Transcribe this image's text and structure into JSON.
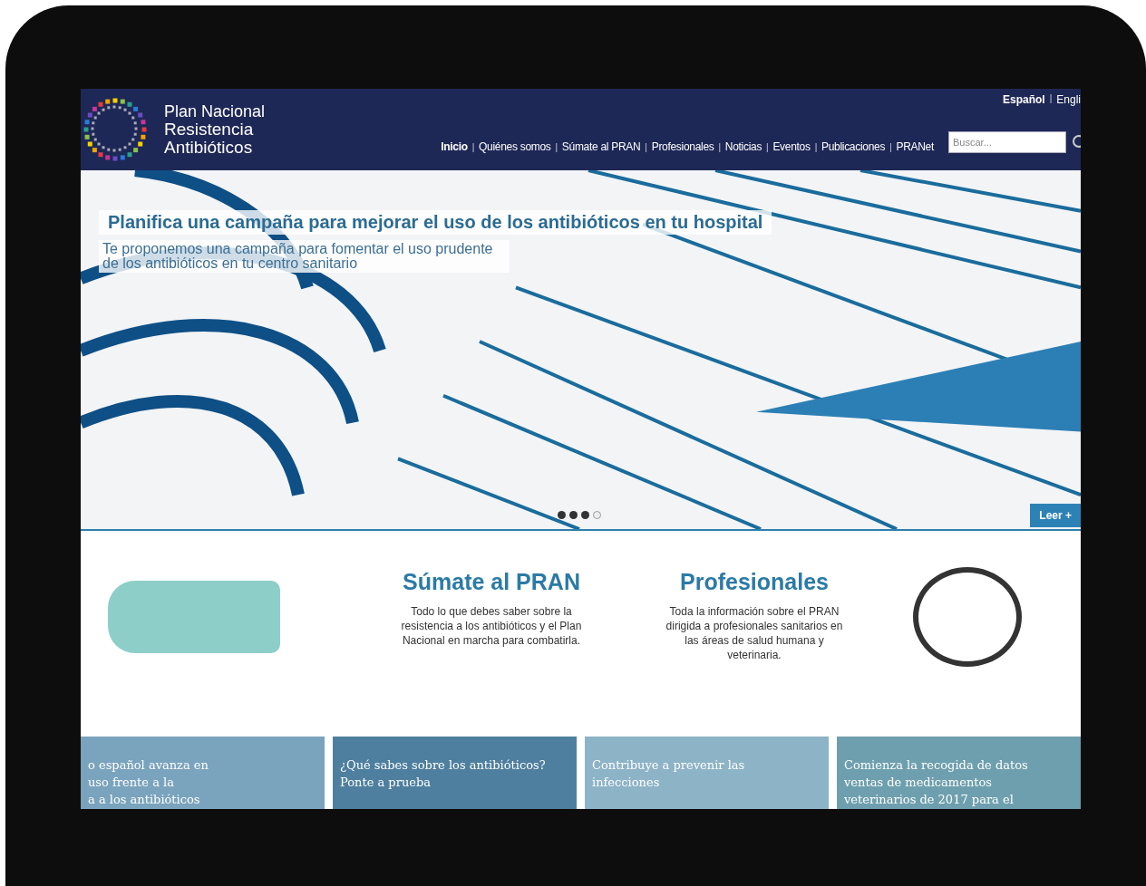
{
  "header": {
    "logo_lines": [
      "Plan Nacional",
      "Resistencia",
      "Antibióticos"
    ],
    "languages": [
      {
        "label": "Español",
        "selected": true
      },
      {
        "label": "Engli",
        "selected": false
      }
    ],
    "separator": "|",
    "nav": [
      {
        "label": "Inicio",
        "selected": true
      },
      {
        "label": "Quiénes somos",
        "selected": false
      },
      {
        "label": "Súmate al PRAN",
        "selected": false
      },
      {
        "label": "Profesionales",
        "selected": false
      },
      {
        "label": "Noticias",
        "selected": false
      },
      {
        "label": "Eventos",
        "selected": false
      },
      {
        "label": "Publicaciones",
        "selected": false
      },
      {
        "label": "PRANet",
        "selected": false
      }
    ],
    "search": {
      "placeholder": "Buscar..."
    }
  },
  "hero": {
    "title": "Planifica una campaña para mejorar el uso de los antibióticos en tu hospital",
    "subtitle": "Te proponemos una campaña para fomentar el uso prudente de los antibióticos en tu centro sanitario",
    "dots": [
      {
        "selected": false
      },
      {
        "selected": false
      },
      {
        "selected": false
      },
      {
        "selected": true
      }
    ],
    "button": "Leer +"
  },
  "features": [
    {
      "title": "Súmate al PRAN",
      "text": "Todo lo que debes saber sobre la resistencia a los antibióticos y el Plan Nacional en marcha para combatirla."
    },
    {
      "title": "Profesionales",
      "text": "Toda la información sobre el PRAN dirigida a profesionales sanitarios en las áreas de salud humana y veterinaria."
    }
  ],
  "news": [
    {
      "lines": [
        "o español avanza en",
        "uso frente a la",
        "a a los antibióticos"
      ]
    },
    {
      "lines": [
        "¿Qué sabes sobre los antibióticos?",
        "Ponte a prueba"
      ]
    },
    {
      "lines": [
        "Contribuye a prevenir las",
        "infecciones"
      ]
    },
    {
      "lines": [
        "Comienza la recogida de datos",
        "ventas de medicamentos",
        "veterinarios de 2017 para el"
      ]
    }
  ]
}
